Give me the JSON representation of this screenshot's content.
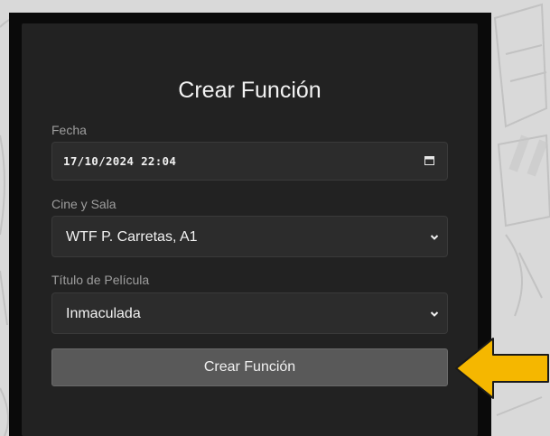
{
  "form": {
    "title": "Crear Función",
    "date_label": "Fecha",
    "date_value": "17/10/2024 22:04",
    "cinema_label": "Cine y Sala",
    "cinema_value": "WTF P. Carretas, A1",
    "movie_label": "Título de Película",
    "movie_value": "Inmaculada",
    "submit_label": "Crear Función"
  },
  "icons": {
    "date": "calendar-icon",
    "select": "chevron-down-icon",
    "annotation": "arrow-left-icon"
  },
  "colors": {
    "card_background": "#222222",
    "field_background": "#2c2c2c",
    "button_background": "#595959",
    "annotation_arrow": "#f5b700"
  }
}
